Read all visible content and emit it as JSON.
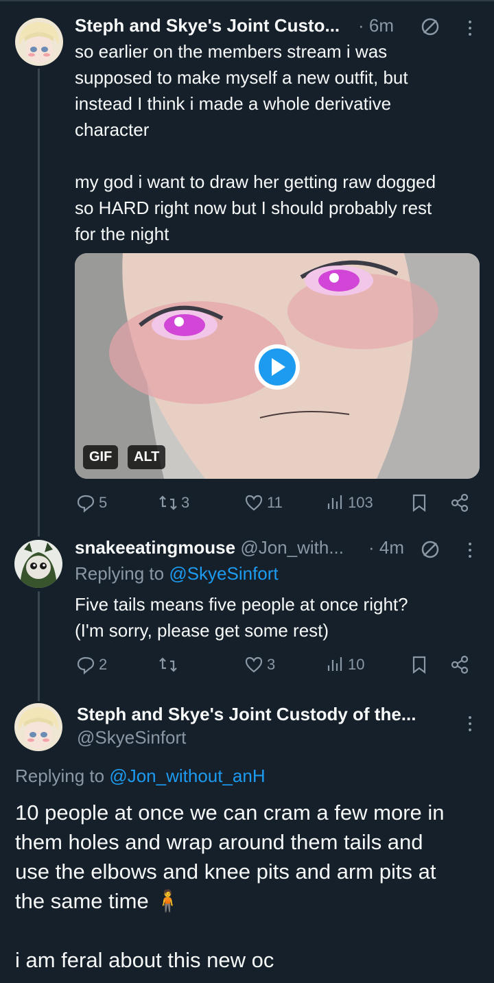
{
  "tweet1": {
    "name": "Steph and Skye's Joint Custo...",
    "time": "· 6m",
    "text": "so earlier on the members stream i was\nsupposed to make myself a new outfit, but\ninstead I think i made a whole derivative\ncharacter\n\nmy god i want to draw her getting raw dogged\nso HARD right now but I should probably rest\nfor the night",
    "media": {
      "gif_label": "GIF",
      "alt_label": "ALT"
    },
    "actions": {
      "replies": "5",
      "retweets": "3",
      "likes": "11",
      "views": "103"
    }
  },
  "tweet2": {
    "name": "snakeeatingmouse",
    "handle": "@Jon_with...",
    "time": "· 4m",
    "replying_prefix": "Replying to",
    "replying_handle": "@SkyeSinfort",
    "text": "Five tails means five people at once right?\n(I'm sorry, please get some rest)",
    "actions": {
      "replies": "2",
      "retweets": "",
      "likes": "3",
      "views": "10"
    }
  },
  "tweet3": {
    "name": "Steph and Skye's Joint Custody of the...",
    "handle": "@SkyeSinfort",
    "replying_prefix": "Replying to",
    "replying_handle": "@Jon_without_anH",
    "text": "10 people at once we can cram a few more in\nthem holes and wrap around them tails and\nuse the elbows and knee pits and arm pits at\nthe same time 🧍\n\ni am feral about this new oc"
  },
  "colors": {
    "background": "#15202b",
    "accent": "#1d9bf0",
    "muted": "#8b98a5"
  }
}
